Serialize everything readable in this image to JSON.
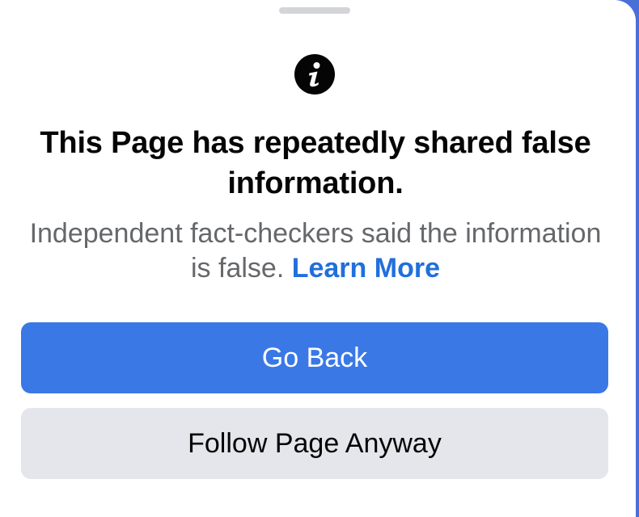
{
  "sheet": {
    "grabber_icon": "drag-handle",
    "info_icon": "info-circle-icon",
    "title": "This Page has repeatedly shared false information.",
    "subtitle_text": "Independent fact-checkers said the information is false.",
    "learn_more_label": "Learn More"
  },
  "actions": {
    "primary_label": "Go Back",
    "secondary_label": "Follow Page Anyway"
  },
  "colors": {
    "primary_button": "#3a78e6",
    "secondary_button": "#e4e6eb",
    "link": "#216fdb",
    "title_text": "#050505",
    "subtitle_text": "#65676b",
    "backdrop": "#4a6fd8"
  }
}
